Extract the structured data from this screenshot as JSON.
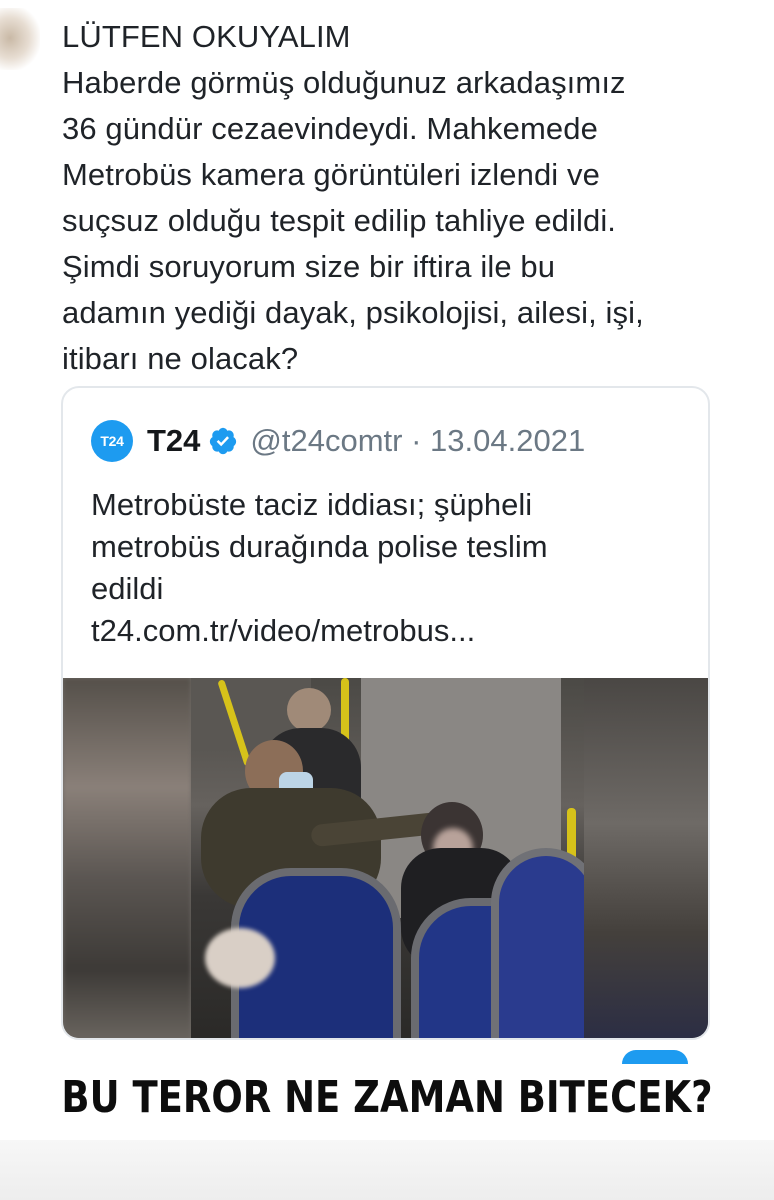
{
  "tweet": {
    "lines": [
      "LÜTFEN OKUYALIM",
      "Haberde görmüş olduğunuz arkadaşımız",
      "36 gündür cezaevindeydi. Mahkemede",
      "Metrobüs kamera görüntüleri izlendi ve",
      "suçsuz olduğu tespit edilip tahliye edildi.",
      "Şimdi soruyorum size bir iftira ile bu",
      "adamın yediği dayak, psikolojisi, ailesi, işi,",
      "itibarı ne olacak?"
    ]
  },
  "quoted": {
    "logo_text": "T24",
    "account_name": "T24",
    "handle_date": "@t24comtr · 13.04.2021",
    "title_lines": [
      "Metrobüste taciz iddiası; şüpheli",
      "metrobüs durağında polise teslim",
      "edildi",
      "t24.com.tr/video/metrobus..."
    ]
  },
  "banner": {
    "text": "BU TEROR NE ZAMAN BITECEK?"
  },
  "colors": {
    "verified": "#1d9bf0",
    "handle": "#6b7884"
  },
  "icons": {
    "verified": "verified-badge-icon",
    "logo": "t24-logo"
  }
}
